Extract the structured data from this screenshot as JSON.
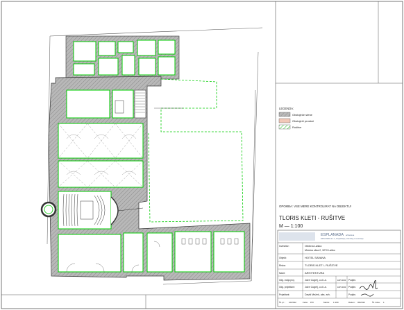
{
  "legend": {
    "title": "LEGENDA:",
    "items": [
      {
        "label": "Obstoječe stene",
        "swatch": "hatch-grey"
      },
      {
        "label": "Obstoječi prostori",
        "swatch": "salmon"
      },
      {
        "label": "Rušitve",
        "swatch": "hatch-green"
      }
    ]
  },
  "note": "OPOMBA: VSE MERE KONTROLIRAT NA OBJEKTU!",
  "sheet": {
    "title": "TLORIS KLETI - RUŠITVE",
    "scale": "M — 1:100"
  },
  "company": {
    "name": "ESPLANADA",
    "tagline": "arhitektura",
    "details": "ESPLANADA d.o.o., Projektiranje, inženiring in svetovanje"
  },
  "title_block": {
    "rows": [
      {
        "label": "Investitor:",
        "value": "Občina Laško",
        "value2": "Mestna ulica 2, 3270 Laško"
      },
      {
        "label": "Objekt:",
        "value": "HOTEL SAVANA"
      },
      {
        "label": "Risba:",
        "value": "TLORIS KLETI - RUŠITVE"
      },
      {
        "label": "Načrt:",
        "value": "ARHITEKTURA"
      }
    ],
    "people": [
      {
        "role": "Odg. vodja proj.",
        "name": "Jože Cugelj, u.d.i.a.",
        "id": "ZAPS 0000",
        "sign": "Podpis:"
      },
      {
        "role": "Odg. projektant:",
        "name": "Jože Cugelj, u.d.i.a.",
        "id": "ZAPS 0000",
        "sign": "Podpis:"
      },
      {
        "role": "Projektant:",
        "name": "David Mežek, abs. arh.",
        "id": "",
        "sign": "Podpis:"
      }
    ],
    "footer": [
      {
        "label": "Št. pr.:",
        "value": "10/2012"
      },
      {
        "label": "Faza:",
        "value": "PZI"
      },
      {
        "label": "Merilo:",
        "value": "1:100"
      },
      {
        "label": "Datum:",
        "value": "06/2012"
      },
      {
        "label": "Št. risbe:",
        "value": "1"
      }
    ]
  },
  "colors": {
    "wall": "#9a9a9a",
    "demolition": "#00cc00",
    "line": "#2a2a2a",
    "salmon": "#f2c8b8",
    "brand": "#5a6e8c"
  }
}
